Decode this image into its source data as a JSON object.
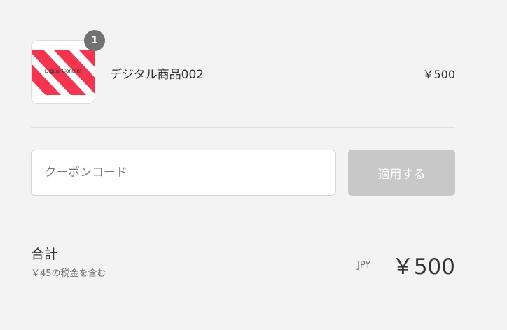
{
  "line_item": {
    "quantity": "1",
    "thumbnail_text": "Digital Content",
    "name": "デジタル商品002",
    "price": "￥500"
  },
  "coupon": {
    "placeholder": "クーポンコード",
    "value": "",
    "apply_label": "適用する"
  },
  "totals": {
    "label": "合計",
    "tax_note": "￥45の税金を含む",
    "currency_code": "JPY",
    "amount": "￥500"
  },
  "colors": {
    "thumbnail_stripe": "#f5344f",
    "badge": "#727272",
    "button_disabled": "#c8c8c8"
  }
}
